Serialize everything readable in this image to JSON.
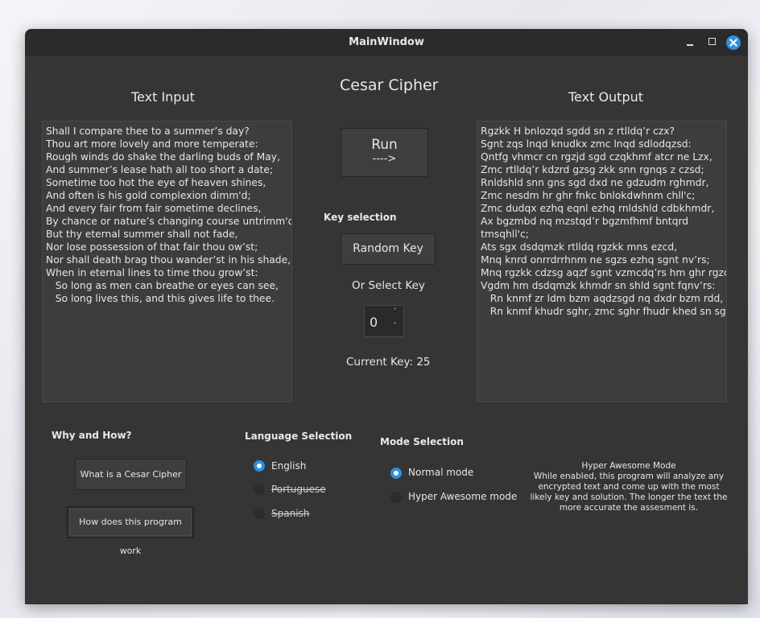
{
  "window": {
    "title": "MainWindow"
  },
  "app_title": "Cesar Cipher",
  "input": {
    "heading": "Text Input",
    "text": "Shall I compare thee to a summer’s day?\nThou art more lovely and more temperate:\nRough winds do shake the darling buds of May,\nAnd summer’s lease hath all too short a date;\nSometime too hot the eye of heaven shines,\nAnd often is his gold complexion dimm'd;\nAnd every fair from fair sometime declines,\nBy chance or nature’s changing course untrimm'd;\nBut thy eternal summer shall not fade,\nNor lose possession of that fair thou ow’st;\nNor shall death brag thou wander’st in his shade,\nWhen in eternal lines to time thou grow’st:\n   So long as men can breathe or eyes can see,\n   So long lives this, and this gives life to thee."
  },
  "output": {
    "heading": "Text Output",
    "text": "Rgzkk H bnlozqd sgdd sn z rtlldq’r czx?\nSgnt zqs lnqd knudkx zmc lnqd sdlodqzsd:\nQntfg vhmcr cn rgzjd sgd czqkhmf atcr ne Lzx,\nZmc rtlldq’r kdzrd gzsg zkk snn rgnqs z czsd;\nRnldshld snn gns sgd dxd ne gdzudm rghmdr,\nZmc nesdm hr ghr fnkc bnlokdwhnm chll'c;\nZmc dudqx ezhq eqnl ezhq rnldshld cdbkhmdr,\nAx bgzmbd nq mzstqd’r bgzmfhmf bntqrd\ntmsqhll'c;\nAts sgx dsdqmzk rtlldq rgzkk mns ezcd,\nMnq knrd onrrdrrhnm ne sgzs ezhq sgnt nv’rs;\nMnq rgzkk cdzsg aqzf sgnt vzmcdq’rs hm ghr rgzcd,\nVgdm hm dsdqmzk khmdr sn shld sgnt fqnv’rs:\n   Rn knmf zr ldm bzm aqdzsgd nq dxdr bzm rdd,\n   Rn knmf khudr sghr, zmc sghr fhudr khed sn sgdd."
  },
  "run_button": {
    "line1": "Run",
    "line2": "---->"
  },
  "key_selection": {
    "heading": "Key selection",
    "random_button": "Random Key",
    "or_select_label": "Or Select Key",
    "spinbox_value": "0",
    "current_key_label": "Current Key: 25"
  },
  "why_how": {
    "heading": "Why and How?",
    "what_button": "What is a Cesar Cipher",
    "how_button": "How does this program work"
  },
  "language": {
    "heading": "Language Selection",
    "options": [
      {
        "label": "English",
        "selected": true,
        "enabled": true
      },
      {
        "label": "Portuguese",
        "selected": false,
        "enabled": false
      },
      {
        "label": "Spanish",
        "selected": false,
        "enabled": false
      }
    ]
  },
  "mode": {
    "heading": "Mode Selection",
    "options": [
      {
        "label": "Normal mode",
        "selected": true
      },
      {
        "label": "Hyper Awesome mode",
        "selected": false
      }
    ]
  },
  "hyper_note": {
    "title": "Hyper Awesome Mode",
    "body": "While enabled, this program will analyze any\nencrypted text and come up with the most\nlikely key and solution. The longer the text the\nmore accurate the assesment is."
  },
  "colors": {
    "accent": "#2e8fe0",
    "window_bg": "#353535",
    "titlebar_bg": "#2b2b2b"
  }
}
